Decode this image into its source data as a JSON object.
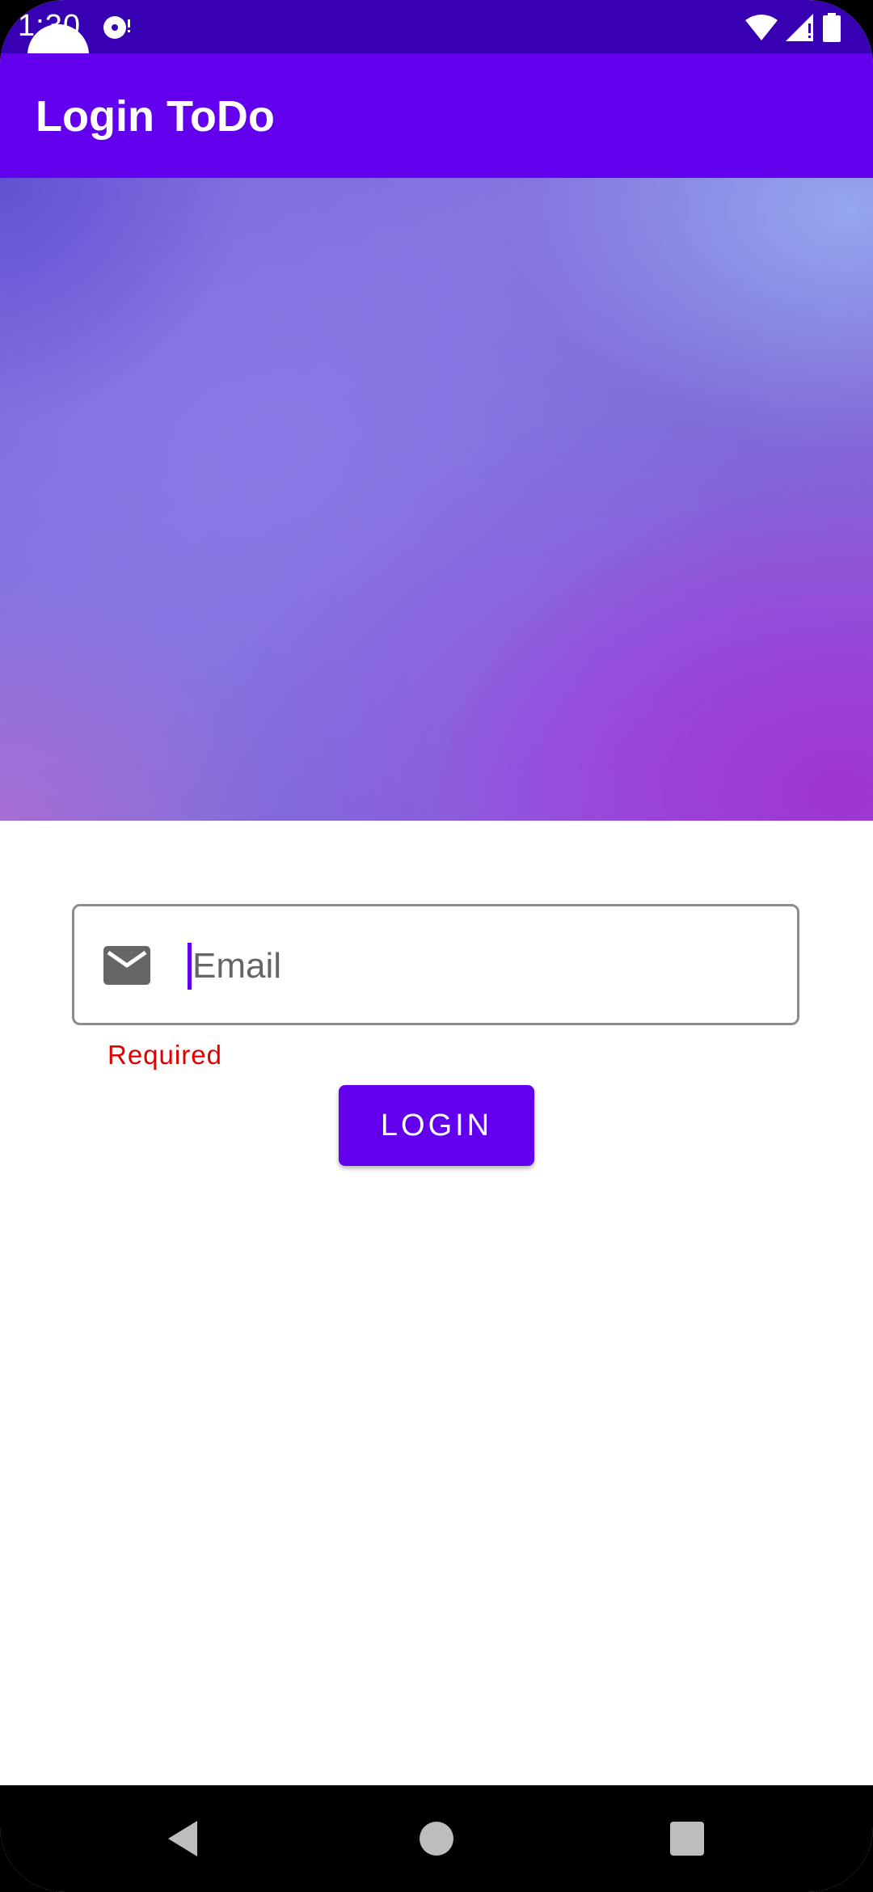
{
  "status_bar": {
    "time": "1:30",
    "icons": [
      "disc-icon",
      "wifi-icon",
      "cell-signal-icon",
      "battery-icon"
    ]
  },
  "app_bar": {
    "title": "Login ToDo",
    "color": "#6200ee"
  },
  "hero": {
    "icon": "gradient-image"
  },
  "email_field": {
    "placeholder": "Email",
    "value": "",
    "icon": "mail-icon",
    "error_text": "Required",
    "error_color": "#e00000"
  },
  "login_button": {
    "label": "LOGIN",
    "color": "#6200ee"
  },
  "nav_bar": {
    "buttons": [
      "back-icon",
      "home-icon",
      "recents-icon"
    ]
  }
}
